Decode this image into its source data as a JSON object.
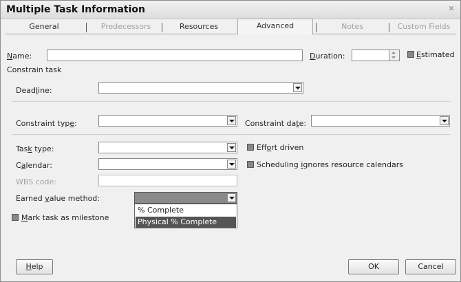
{
  "window": {
    "title": "Multiple Task Information",
    "close_glyph": "✕"
  },
  "tabs": [
    {
      "label": "General",
      "state": "normal"
    },
    {
      "label": "Predecessors",
      "state": "disabled"
    },
    {
      "label": "Resources",
      "state": "normal"
    },
    {
      "label": "Advanced",
      "state": "active"
    },
    {
      "label": "Notes",
      "state": "disabled"
    },
    {
      "label": "Custom Fields",
      "state": "disabled"
    }
  ],
  "name": {
    "label_pre": "",
    "label_u": "N",
    "label_post": "ame:",
    "value": ""
  },
  "duration": {
    "label_pre": "",
    "label_u": "D",
    "label_post": "uration:",
    "value": ""
  },
  "estimated": {
    "label_pre": "",
    "label_u": "E",
    "label_post": "stimated",
    "checked": false
  },
  "section_title": "Constrain task",
  "deadline": {
    "label_pre": "Dead",
    "label_u": "l",
    "label_post": "ine:",
    "value": ""
  },
  "constraint_type": {
    "label_pre": "Constraint typ",
    "label_u": "e",
    "label_post": ":",
    "value": ""
  },
  "constraint_date": {
    "label_pre": "Constraint da",
    "label_u": "t",
    "label_post": "e:",
    "value": ""
  },
  "task_type": {
    "label_pre": "Tas",
    "label_u": "k",
    "label_post": " type:",
    "value": ""
  },
  "effort_driven": {
    "label_pre": "Eff",
    "label_u": "o",
    "label_post": "rt driven",
    "checked": false
  },
  "calendar": {
    "label_pre": "C",
    "label_u": "a",
    "label_post": "lendar:",
    "value": ""
  },
  "scheduling_ignores": {
    "label_pre": "Scheduling ",
    "label_u": "i",
    "label_post": "gnores resource calendars",
    "checked": false
  },
  "wbs_code": {
    "label": "WBS code:",
    "value": ""
  },
  "earned_value": {
    "label_pre": "Earned ",
    "label_u": "v",
    "label_post": "alue method:",
    "value": "",
    "options": [
      "% Complete",
      "Physical % Complete"
    ],
    "highlighted_index": 1
  },
  "mark_milestone": {
    "label_pre": "",
    "label_u": "M",
    "label_post": "ark task as milestone",
    "checked": false
  },
  "buttons": {
    "help_pre": "",
    "help_u": "H",
    "help_post": "elp",
    "ok": "OK",
    "cancel": "Cancel"
  }
}
